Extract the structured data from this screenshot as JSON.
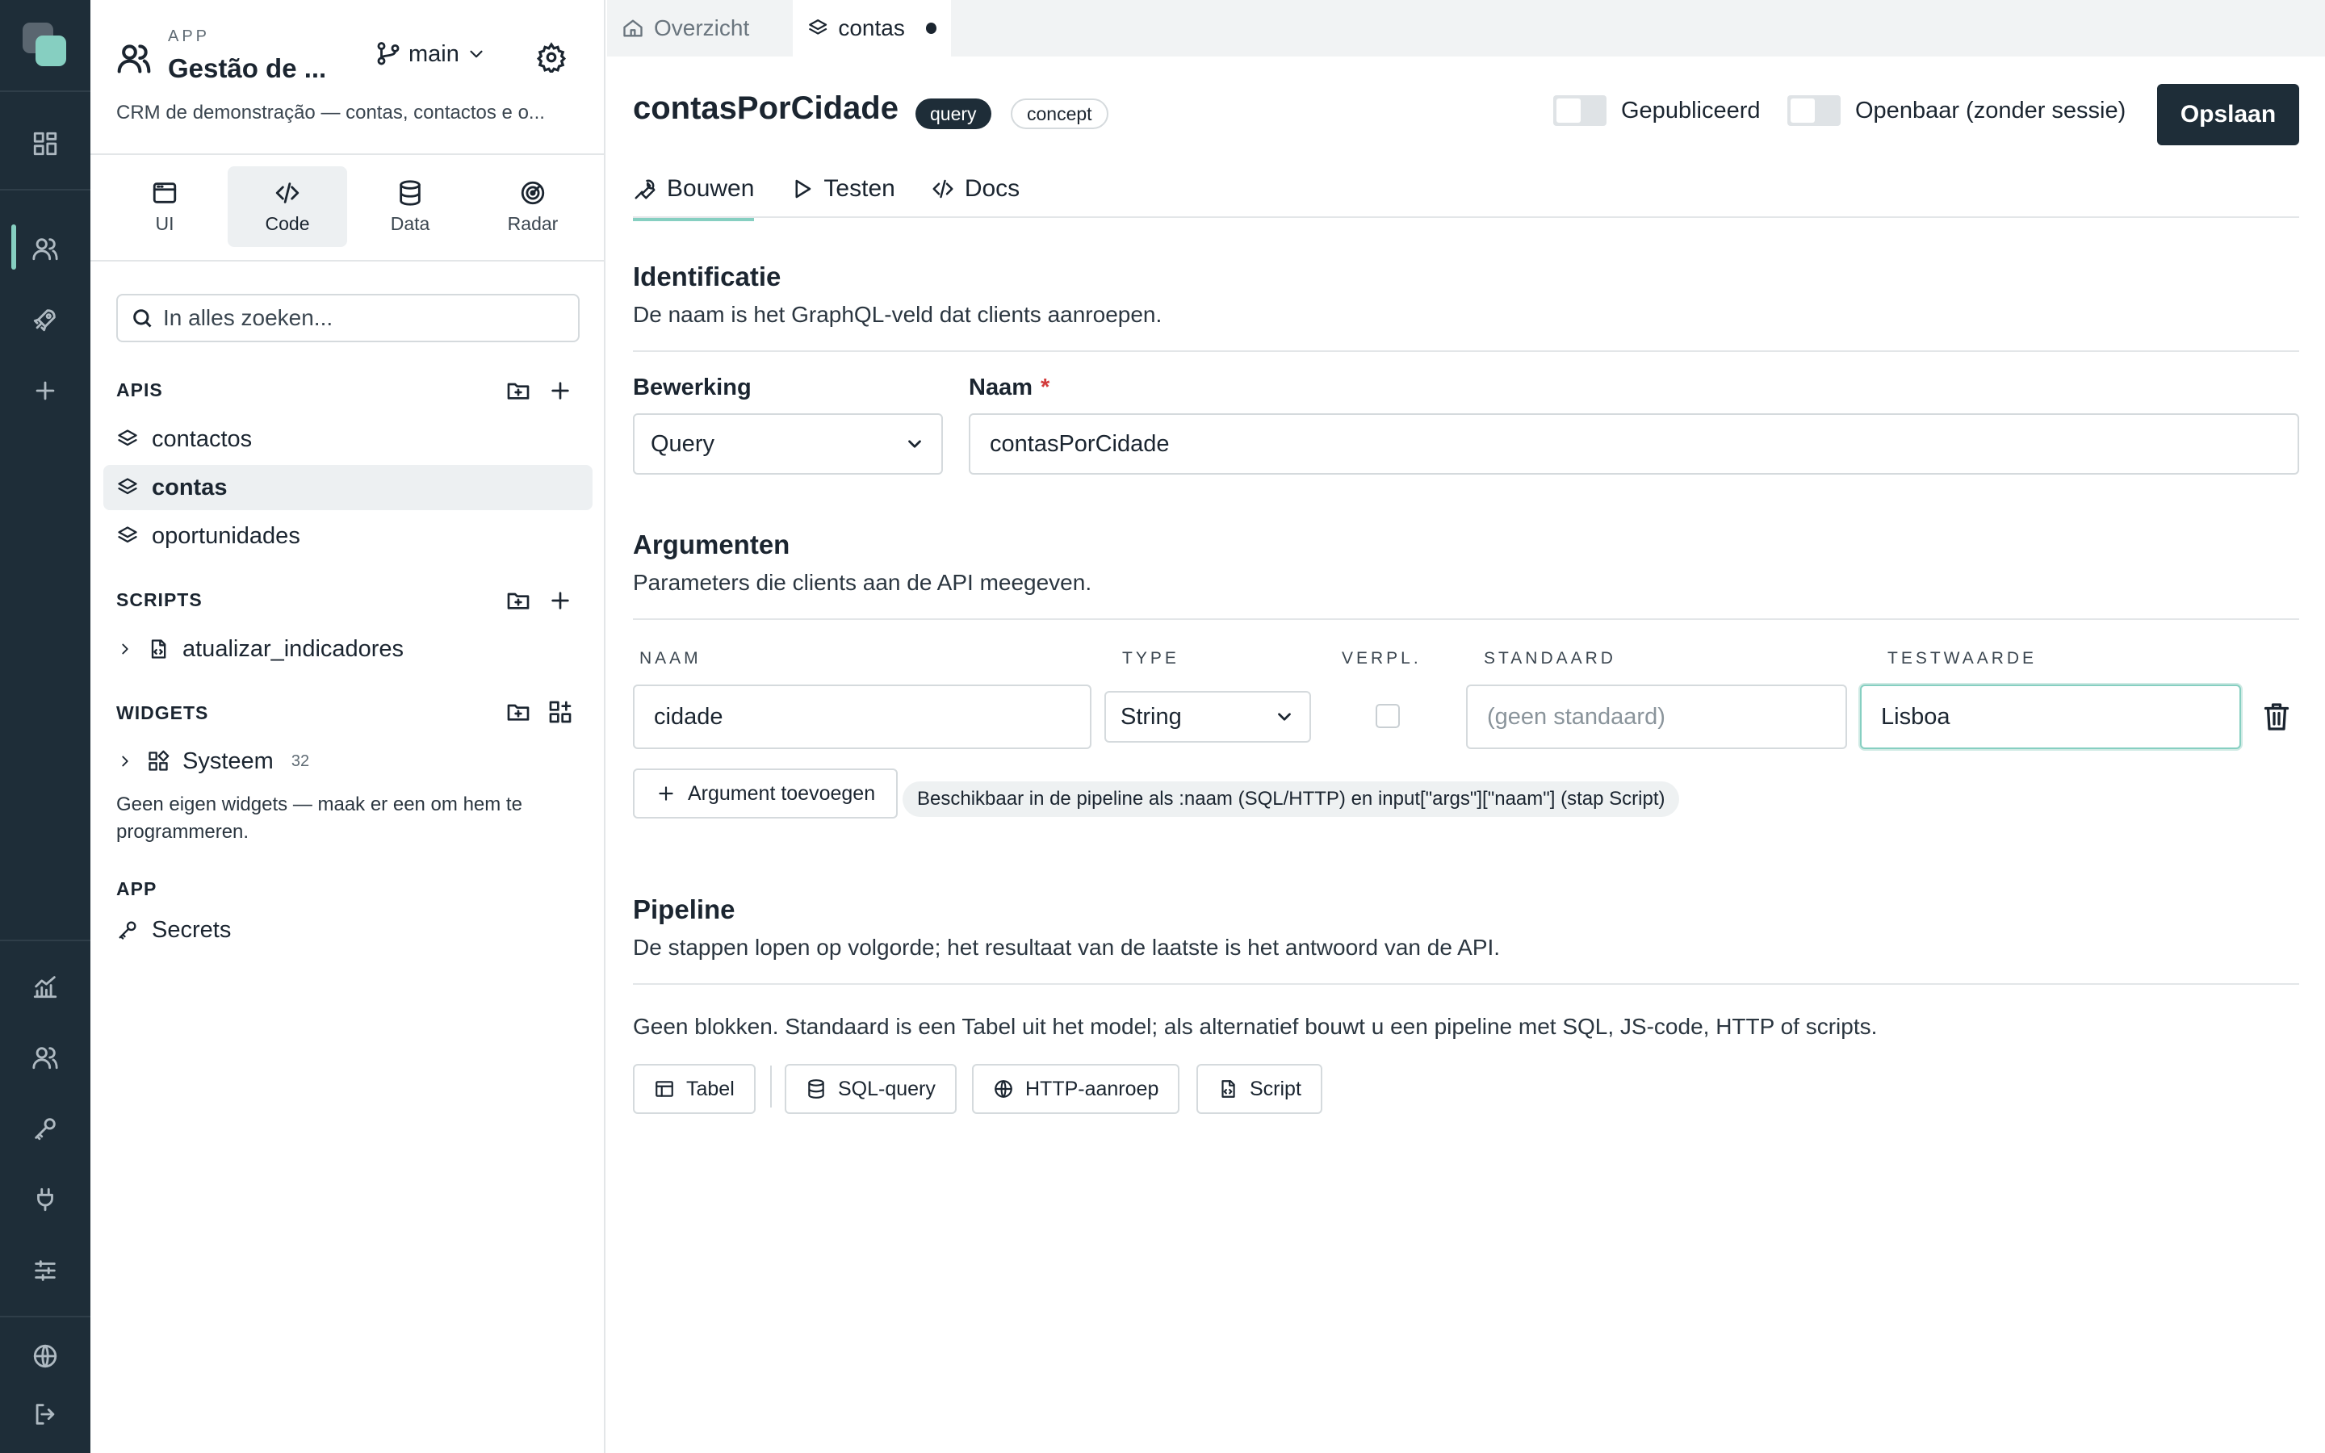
{
  "sidebar": {
    "app_kicker": "APP",
    "app_name": "Gestão de ...",
    "branch": "main",
    "app_description": "CRM de demonstração — contas, contactos e o...",
    "modes": [
      {
        "label": "UI",
        "icon": "window-icon"
      },
      {
        "label": "Code",
        "icon": "code-icon"
      },
      {
        "label": "Data",
        "icon": "database-icon"
      },
      {
        "label": "Radar",
        "icon": "radar-icon"
      }
    ],
    "active_mode": "Code",
    "search_placeholder": "In alles zoeken...",
    "apis": {
      "heading": "APIS",
      "items": [
        "contactos",
        "contas",
        "oportunidades"
      ],
      "active": "contas"
    },
    "scripts": {
      "heading": "SCRIPTS",
      "items": [
        "atualizar_indicadores"
      ]
    },
    "widgets": {
      "heading": "WIDGETS",
      "items": [
        {
          "label": "Systeem",
          "count": "32"
        }
      ],
      "empty_note": "Geen eigen widgets — maak er een om hem te programmeren."
    },
    "app_section": {
      "heading": "APP",
      "items": [
        "Secrets"
      ]
    }
  },
  "tabs": [
    {
      "label": "Overzicht",
      "icon": "home-icon"
    },
    {
      "label": "contas",
      "icon": "layers-icon",
      "modified": true
    }
  ],
  "header": {
    "title": "contasPorCidade",
    "badge_type": "query",
    "badge_status": "concept",
    "toggle_published": "Gepubliceerd",
    "toggle_public": "Openbaar (zonder sessie)",
    "published_on": false,
    "public_on": false,
    "save_label": "Opslaan"
  },
  "subtabs": [
    {
      "label": "Bouwen",
      "icon": "wrench-icon"
    },
    {
      "label": "Testen",
      "icon": "play-icon"
    },
    {
      "label": "Docs",
      "icon": "code-icon"
    }
  ],
  "identification": {
    "heading": "Identificatie",
    "description": "De naam is het GraphQL-veld dat clients aanroepen.",
    "operation_label": "Bewerking",
    "operation_value": "Query",
    "name_label": "Naam",
    "name_required": "*",
    "name_value": "contasPorCidade"
  },
  "arguments": {
    "heading": "Argumenten",
    "description": "Parameters die clients aan de API meegeven.",
    "columns": [
      "NAAM",
      "TYPE",
      "VERPL.",
      "STANDAARD",
      "TESTWAARDE"
    ],
    "rows": [
      {
        "name": "cidade",
        "type": "String",
        "required": false,
        "default_placeholder": "(geen standaard)",
        "default": "",
        "test_value": "Lisboa"
      }
    ],
    "add_label": "Argument toevoegen",
    "hint": "Beschikbaar in de pipeline als :naam (SQL/HTTP) en input[\"args\"][\"naam\"] (stap Script)"
  },
  "pipeline": {
    "heading": "Pipeline",
    "description": "De stappen lopen op volgorde; het resultaat van de laatste is het antwoord van de API.",
    "empty_note": "Geen blokken. Standaard is een Tabel uit het model; als alternatief bouwt u een pipeline met SQL, JS-code, HTTP of scripts.",
    "blocks": [
      {
        "label": "Tabel",
        "icon": "table-icon"
      },
      {
        "label": "SQL-query",
        "icon": "database-icon"
      },
      {
        "label": "HTTP-aanroep",
        "icon": "globe-icon"
      },
      {
        "label": "Script",
        "icon": "script-icon"
      }
    ]
  },
  "colors": {
    "rail": "#1e2d38",
    "accent": "#86cfc1",
    "primary_button": "#1e2d38",
    "required": "#d23b3b"
  }
}
